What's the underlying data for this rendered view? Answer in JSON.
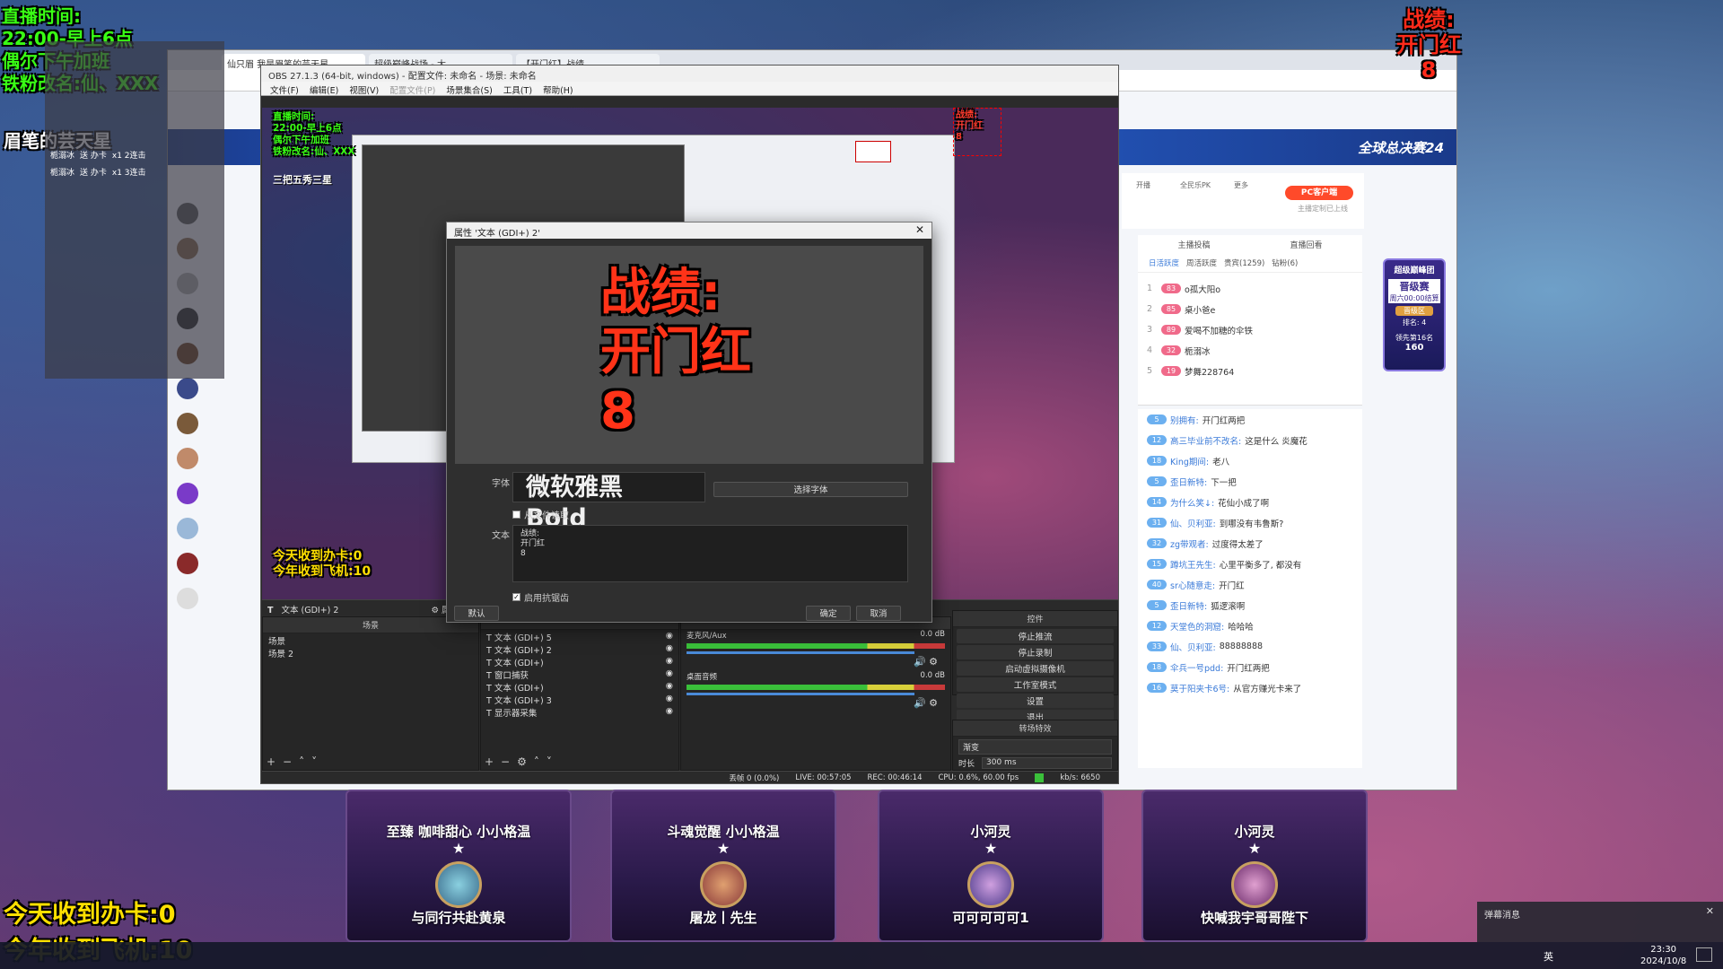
{
  "overlay_left": {
    "line1": "直播时间:",
    "line2": "22:00-早上6点",
    "line3": "偶尔下午加班",
    "line4": "铁粉改名:仙、XXX",
    "streamer_name": "眉笔的芸天星",
    "bottom_line1": "今天收到办卡:0",
    "bottom_line2": "今年收到飞机:10"
  },
  "overlay_right": {
    "line1": "战绩:",
    "line2": "开门红",
    "line3": "8"
  },
  "mini_panel": {
    "rows": [
      {
        "user": "栀溺冰",
        "action": "送 办卡",
        "count": "x1 2连击"
      },
      {
        "user": "栀溺冰",
        "action": "送 办卡",
        "count": "x1 3连击"
      }
    ]
  },
  "browser": {
    "tabs": [
      "仙只眉 我是眉笔的芸天星",
      "超级巅峰战场 - 大...",
      "【开门红】战绩..."
    ],
    "banner_text": "全球总决赛24"
  },
  "obs": {
    "title": "OBS 27.1.3 (64-bit, windows) - 配置文件: 未命名 - 场景: 未命名",
    "menu": [
      "文件(F)",
      "编辑(E)",
      "视图(V)",
      "配置文件(P)",
      "场景集合(S)",
      "工具(T)",
      "帮助(H)"
    ],
    "source_bar_label": "文本 (GDI+) 2",
    "properties_btn": "属性",
    "scenes_header": "场景",
    "scenes": [
      "场景",
      "场景 2"
    ],
    "sources": [
      "文本 (GDI+) 5",
      "文本 (GDI+) 2",
      "文本 (GDI+)",
      "窗口捕获",
      "文本 (GDI+)",
      "文本 (GDI+) 3",
      "显示器采集"
    ],
    "audio": [
      {
        "name": "麦克风/Aux",
        "db": "0.0 dB"
      },
      {
        "name": "桌面音频",
        "db": "0.0 dB"
      }
    ],
    "controls_header": "控件",
    "controls": [
      "停止推流",
      "停止录制",
      "启动虚拟摄像机",
      "工作室模式",
      "设置",
      "退出"
    ],
    "transition_header": "转场特效",
    "transition_value": "渐变",
    "duration_label": "时长",
    "duration_value": "300 ms",
    "status": {
      "dropped": "丢帧 0 (0.0%)",
      "live": "LIVE: 00:57:05",
      "rec": "REC: 00:46:14",
      "cpu": "CPU: 0.6%, 60.00 fps",
      "kbps": "kb/s: 6650"
    }
  },
  "dialog": {
    "title": "属性 '文本 (GDI+) 2'",
    "preview_line1": "战绩:",
    "preview_line2": "开门红",
    "preview_line3": "8",
    "font_label": "字体",
    "font_value": "微软雅黑 Bold",
    "choose_font": "选择字体",
    "from_file": "从文件读取",
    "text_label": "文本",
    "text_lines": [
      "战绩:",
      "开门红",
      "8"
    ],
    "antialias": "启用抗锯齿",
    "defaults": "默认",
    "ok": "确定",
    "cancel": "取消"
  },
  "side_widget": {
    "items": [
      "开播",
      "全民乐PK",
      "更多"
    ],
    "pc_btn": "PC客户端",
    "pc_sub": "主播定制已上线",
    "tabs": [
      "日活跃度",
      "周活跃度",
      "贵宾(1259)",
      "钻粉(6)"
    ],
    "rank_header_left": "主播投稿",
    "rank_header_right": "直播回看"
  },
  "ranking": [
    {
      "rank": "1",
      "level": "83",
      "name": "o孤大阳o"
    },
    {
      "rank": "2",
      "level": "85",
      "name": "桌小爸e"
    },
    {
      "rank": "3",
      "level": "89",
      "name": "爱喝不加糖的伞铁"
    },
    {
      "rank": "4",
      "level": "32",
      "name": "栀溺冰"
    },
    {
      "rank": "5",
      "level": "19",
      "name": "梦舞228764"
    }
  ],
  "chat": [
    {
      "level": "5",
      "name": "别拥有:",
      "msg": "开门红两把"
    },
    {
      "level": "12",
      "name": "高三毕业前不改名:",
      "msg": "这是什么 炎魔花"
    },
    {
      "level": "18",
      "name": "King期间:",
      "msg": "老八"
    },
    {
      "level": "5",
      "name": "歪日新特:",
      "msg": "下一把"
    },
    {
      "level": "14",
      "name": "为什么笑↓:",
      "msg": "花仙小成了啊"
    },
    {
      "level": "31",
      "name": "仙、贝利亚:",
      "msg": "到哪没有韦鲁斯?"
    },
    {
      "level": "32",
      "name": "zg带观者:",
      "msg": "过度得太差了"
    },
    {
      "level": "15",
      "name": "蹲坑王先生:",
      "msg": "心里平衡多了, 都没有"
    },
    {
      "level": "40",
      "name": "sr心随意走:",
      "msg": "开门红"
    },
    {
      "level": "5",
      "name": "歪日新特:",
      "msg": "狐逻滚啊"
    },
    {
      "level": "12",
      "name": "天堂色的洞窟:",
      "msg": "哈哈哈"
    },
    {
      "level": "33",
      "name": "仙、贝利亚:",
      "msg": "88888888"
    },
    {
      "level": "18",
      "name": "伞兵一号pdd:",
      "msg": "开门红两把"
    },
    {
      "level": "16",
      "name": "莫于阳夹卡6号:",
      "msg": "从官方赚光卡来了"
    }
  ],
  "promo": {
    "title": "超级巅峰团",
    "sub": "晋级赛",
    "timer": "周六00:00结算",
    "zone": "晋级区",
    "rank": "排名: 4",
    "lead": "领先第16名",
    "score": "160"
  },
  "cards": [
    {
      "title": "至臻 咖啡甜心 小小格温",
      "caption": "与同行共赴黄泉"
    },
    {
      "title": "斗魂觉醒 小小格温",
      "caption": "屠龙丨先生"
    },
    {
      "title": "小河灵",
      "caption": "可可可可可1"
    },
    {
      "title": "小河灵",
      "caption": "快喊我宇哥哥陛下"
    }
  ],
  "popup": {
    "title": "弹幕消息"
  },
  "taskbar": {
    "time": "23:30",
    "date": "2024/10/8",
    "ime": "英"
  }
}
